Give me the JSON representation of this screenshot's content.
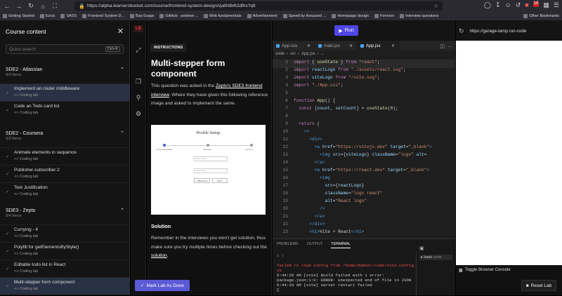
{
  "browser": {
    "url": "https://alpha.learnersbucket.com/course/frontend-system-design/vjalfrtl84t2dfhs?q9",
    "bookmarks": [
      "Getting Started",
      "Ezoic",
      "SASS",
      "Frontend System D...",
      "Bzp Exaps",
      "GitHub - andrew-...",
      "Web fundamentals",
      "Advertisement",
      "Speed by thousand ...",
      "Homepage design",
      "Fermion",
      "Interview questions"
    ],
    "other_bookmarks": "Other Bookmarks",
    "badge_count": "18"
  },
  "sidebar": {
    "title": "Course content",
    "search_placeholder": "Quick search",
    "search_shortcut": "Ctrl+K",
    "sections": [
      {
        "title": "SDE2 - Atlassian",
        "count": "0/3 Items",
        "lessons": [
          {
            "title": "Implement an router middleware",
            "sub": "Coding lab",
            "active": true
          },
          {
            "title": "Code an Todo card list",
            "sub": "Coding lab"
          }
        ]
      },
      {
        "title": "SDE2 - Coursera",
        "count": "0/3 Items",
        "lessons": [
          {
            "title": "Animate elements in sequence",
            "sub": "Coding lab"
          },
          {
            "title": "Publisher-subscriber 2",
            "sub": "Coding lab"
          },
          {
            "title": "Text Justification",
            "sub": "Coding lab"
          }
        ]
      },
      {
        "title": "SDE3 - Zepto",
        "count": "0/4 Items",
        "lessons": [
          {
            "title": "Currying - 4",
            "sub": "Coding lab"
          },
          {
            "title": "Polyfill for getElementsByStyle()",
            "sub": "Coding lab"
          },
          {
            "title": "Editable todo list in React",
            "sub": "Coding lab"
          },
          {
            "title": "Multi-stepper form component",
            "sub": "Coding lab",
            "active": true
          }
        ]
      }
    ]
  },
  "rail": {
    "logo": "LB"
  },
  "instructions": {
    "tab": "INSTRUCTIONS",
    "heading": "Multi-stepper form component",
    "para1_pre": "This question was asked in the ",
    "para1_link": "Zepto's SDE3 frontend interview",
    "para1_post": ". Where they have given this following reference image and asked to implement the same.",
    "preview": {
      "title": "Profile Setup",
      "steps": [
        "Personal Details",
        "Interests",
        "Account"
      ],
      "fields": [
        "First name",
        "Last name"
      ],
      "buttons": [
        "PREVIOUS",
        "NEXT"
      ]
    },
    "solution_heading": "Solution",
    "solution_text_pre": "Remember in the interviews you won't get solution, thus make sure you try multiple times before checking out the ",
    "solution_link": "solution",
    "solution_text_post": ".",
    "mark_done": "Mark Lab As Done"
  },
  "editor": {
    "run": "Run",
    "tabs": [
      "App.css",
      "main.jsx",
      "App.jsx"
    ],
    "active_tab": "App.jsx",
    "breadcrumb": [
      "code",
      "src",
      "App.jsx",
      "..."
    ],
    "lines": [
      "import { useState } from \"react\";",
      "import reactLogo from \"./assets/react.svg\";",
      "import viteLogo from \"/vite.svg\";",
      "import \"./App.css\";",
      "",
      "function App() {",
      "  const [count, setCount] = useState(0);",
      "",
      "  return (",
      "    <>",
      "      <div>",
      "        <a href=\"https://vitejs.dev\" target=\"_blank\">",
      "          <img src={viteLogo} className=\"logo\" alt=",
      "        </a>",
      "        <a href=\"https://react.dev\" target=\"_blank\">",
      "          <img",
      "            src={reactLogo}",
      "            className=\"logo react\"",
      "            alt=\"React logo\"",
      "          />",
      "        </a>",
      "      </div>",
      "      <h1>Vite + React</h1>"
    ],
    "panel_tabs": [
      "PROBLEMS",
      "OUTPUT",
      "TERMINAL"
    ],
    "active_panel": "TERMINAL",
    "terminal": [
      {
        "text": "1  |",
        "cls": "dim"
      },
      {
        "text": "",
        "cls": ""
      },
      {
        "text": "failed to load config from /home/damner/code/vite.config.",
        "cls": "err"
      },
      {
        "text": "js",
        "cls": "err"
      },
      {
        "text": "6:44:20 AM [vite] Build failed with 1 error:",
        "cls": ""
      },
      {
        "text": "package.json:1:0: ERROR: Unexpected end of file in JSON",
        "cls": ""
      },
      {
        "text": "6:44:20 AM [vite] server restart failed",
        "cls": ""
      },
      {
        "text": "▯",
        "cls": ""
      }
    ],
    "terminal_instance": "bash",
    "terminal_folder": "code"
  },
  "preview_browser": {
    "url": "https://garage-lamp.run-code",
    "toggle": "Toggle Browser Console",
    "reset": "Reset Lab"
  }
}
